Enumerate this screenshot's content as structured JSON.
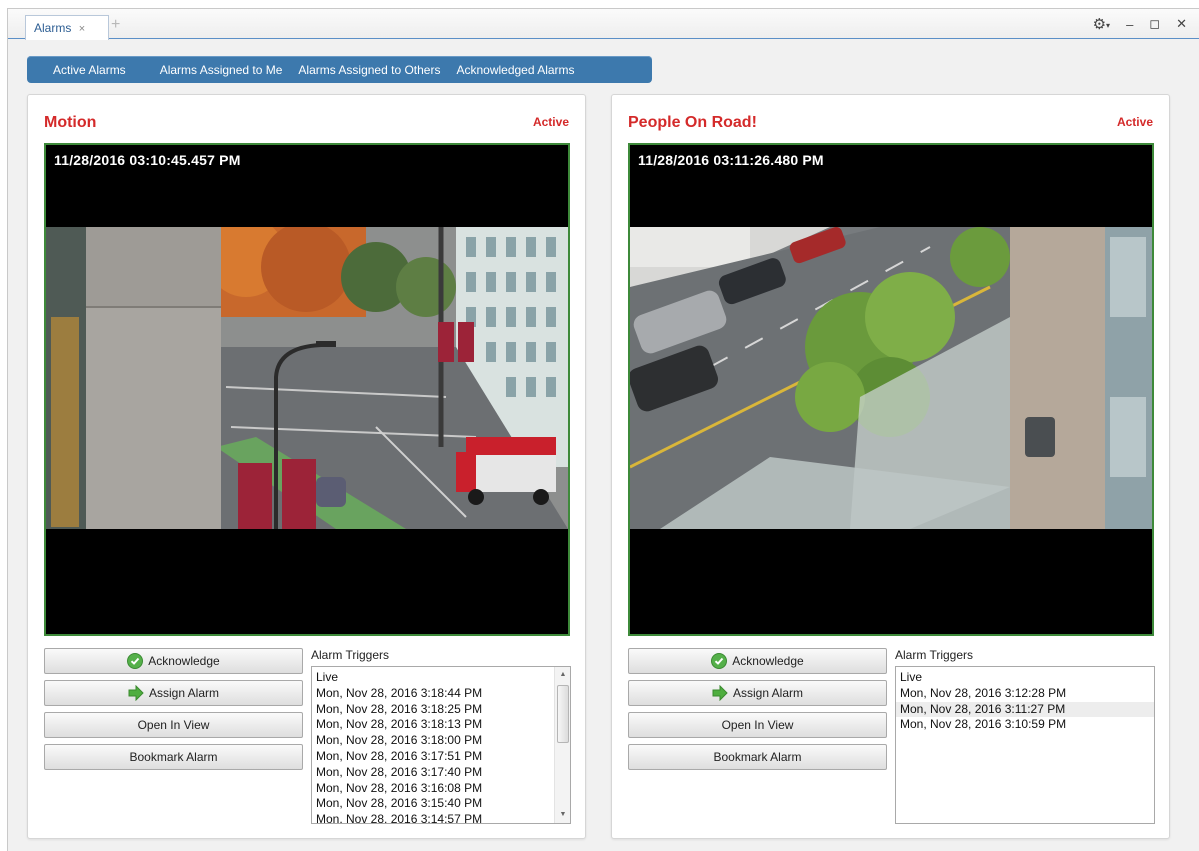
{
  "window": {
    "tab_label": "Alarms",
    "tab_close": "×",
    "new_tab": "+",
    "controls": {
      "settings": "⚙",
      "settings_caret": "▾",
      "minimize": "–",
      "maximize": "◻",
      "close": "✕"
    }
  },
  "filters": [
    {
      "label": "Active Alarms"
    },
    {
      "label": "Alarms Assigned to Me"
    },
    {
      "label": "Alarms Assigned to Others"
    },
    {
      "label": "Acknowledged Alarms"
    }
  ],
  "colors": {
    "accent": "#3d79ad",
    "alarm_red": "#d42a2a",
    "video_border": "#3e8a3a"
  },
  "alarms": [
    {
      "title": "Motion",
      "status": "Active",
      "timestamp": "11/28/2016 03:10:45.457 PM",
      "buttons": {
        "acknowledge": "Acknowledge",
        "assign": "Assign Alarm",
        "open_in_view": "Open In View",
        "bookmark": "Bookmark Alarm"
      },
      "triggers_label": "Alarm Triggers",
      "triggers": [
        "Live",
        "Mon, Nov 28, 2016 3:18:44 PM",
        "Mon, Nov 28, 2016 3:18:25 PM",
        "Mon, Nov 28, 2016 3:18:13 PM",
        "Mon, Nov 28, 2016 3:18:00 PM",
        "Mon, Nov 28, 2016 3:17:51 PM",
        "Mon, Nov 28, 2016 3:17:40 PM",
        "Mon, Nov 28, 2016 3:16:08 PM",
        "Mon, Nov 28, 2016 3:15:40 PM",
        "Mon, Nov 28, 2016 3:14:57 PM"
      ]
    },
    {
      "title": "People On Road!",
      "status": "Active",
      "timestamp": "11/28/2016 03:11:26.480 PM",
      "buttons": {
        "acknowledge": "Acknowledge",
        "assign": "Assign Alarm",
        "open_in_view": "Open In View",
        "bookmark": "Bookmark Alarm"
      },
      "triggers_label": "Alarm Triggers",
      "triggers": [
        "Live",
        "Mon, Nov 28, 2016 3:12:28 PM",
        "Mon, Nov 28, 2016 3:11:27 PM",
        "Mon, Nov 28, 2016 3:10:59 PM"
      ]
    }
  ]
}
